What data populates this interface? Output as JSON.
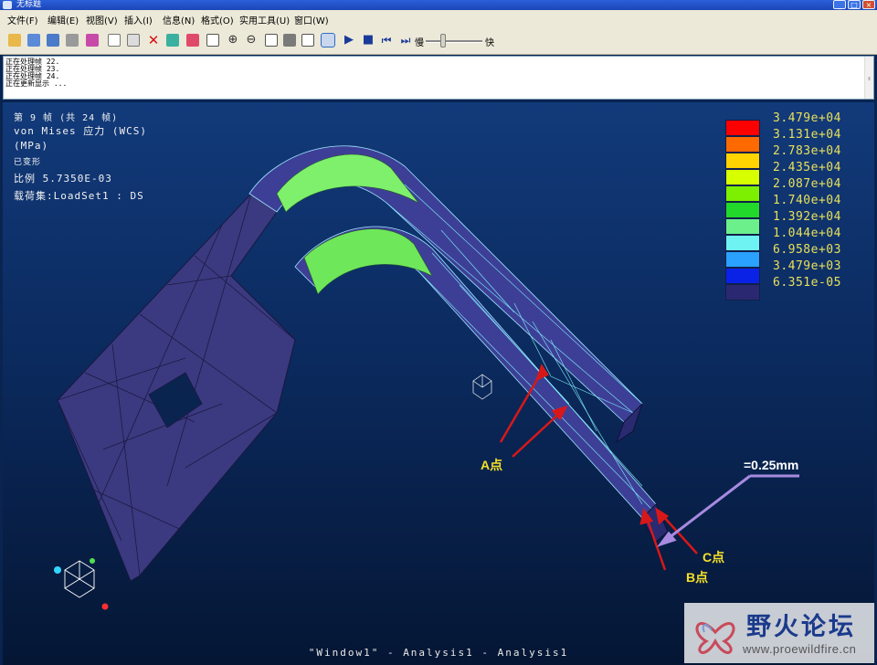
{
  "window": {
    "title": "无标题",
    "buttons": [
      "minimize-icon",
      "maximize-icon",
      "close-icon"
    ]
  },
  "menu": {
    "items": [
      "文件(F)",
      "编辑(E)",
      "视图(V)",
      "插入(I)",
      "信息(N)",
      "格式(O)",
      "实用工具(U)",
      "窗口(W)"
    ]
  },
  "toolbar": {
    "icons": [
      "open-icon",
      "save-icon",
      "save-as-icon",
      "print-icon",
      "model-icon",
      "copy-result-icon",
      "paste-icon",
      "delete-icon",
      "show-icon",
      "edit-icon",
      "fit-icon",
      "zoom-in-icon",
      "zoom-out-icon",
      "zoom-window-icon",
      "orient-icon",
      "query-icon",
      "animate-icon",
      "play-icon",
      "stop-icon",
      "first-frame-icon",
      "next-frame-icon"
    ],
    "speed_slow": "慢",
    "speed_fast": "快",
    "speed_level": 0.3
  },
  "messages": [
    "正在处理帧 22.",
    "正在处理帧 23.",
    "正在处理帧 24.",
    "正在更新显示 ..."
  ],
  "viewport": {
    "frame": "第 9 帧 (共 24 帧)",
    "quantity": "von Mises 应力 (WCS)",
    "unit": "(MPa)",
    "deformed": "已变形",
    "scale": "比例  5.7350E-03",
    "loadset": "载荷集:LoadSet1 :  DS",
    "window_title": "\"Window1\" - Analysis1 - Analysis1"
  },
  "legend": [
    {
      "value": "3.479e+04",
      "color": "#ff0000"
    },
    {
      "value": "3.131e+04",
      "color": "#ff6a00"
    },
    {
      "value": "2.783e+04",
      "color": "#ffd400"
    },
    {
      "value": "2.435e+04",
      "color": "#d8ff00"
    },
    {
      "value": "2.087e+04",
      "color": "#7cf000"
    },
    {
      "value": "1.740e+04",
      "color": "#22d82a"
    },
    {
      "value": "1.392e+04",
      "color": "#6cf08c"
    },
    {
      "value": "1.044e+04",
      "color": "#6ef2f2"
    },
    {
      "value": "6.958e+03",
      "color": "#2aa0ff"
    },
    {
      "value": "3.479e+03",
      "color": "#0a22e6"
    },
    {
      "value": "6.351e-05",
      "color": "#2a2870"
    }
  ],
  "annotations": {
    "point_a": "A点",
    "point_b": "B点",
    "point_c": "C点",
    "gap": "=0.25mm"
  },
  "watermark": {
    "name": "野火论坛",
    "url": "www.proewildfire.cn"
  }
}
